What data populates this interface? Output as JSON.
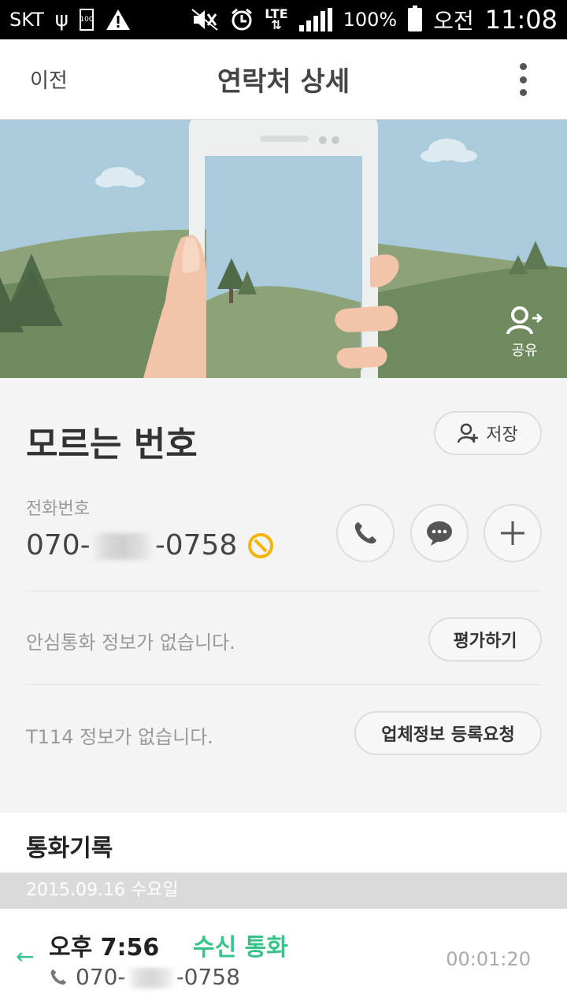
{
  "status_bar": {
    "carrier": "SKT",
    "small_battery_label": "100",
    "network": "LTE",
    "battery": "100%",
    "ampm": "오전",
    "time": "11:08"
  },
  "appbar": {
    "back_label": "이전",
    "title": "연락처 상세"
  },
  "hero": {
    "share_label": "공유"
  },
  "contact": {
    "name": "모르는 번호",
    "save_label": "저장",
    "phone_label": "전화번호",
    "phone_prefix": "070-",
    "phone_suffix": "-0758"
  },
  "safe_call": {
    "text": "안심통화 정보가 없습니다.",
    "button": "평가하기"
  },
  "t114": {
    "text": "T114 정보가 없습니다.",
    "button": "업체정보 등록요청"
  },
  "call_log": {
    "title": "통화기록",
    "date": "2015.09.16 수요일",
    "entries": [
      {
        "time": "오후 7:56",
        "type": "수신 통화",
        "number_prefix": "070-",
        "number_suffix": "-0758",
        "duration": "00:01:20"
      }
    ]
  },
  "colors": {
    "accent_green": "#36c48a",
    "block_yellow": "#f4b400",
    "sky": "#a9cbdc",
    "hill": "#6f8a5e"
  }
}
